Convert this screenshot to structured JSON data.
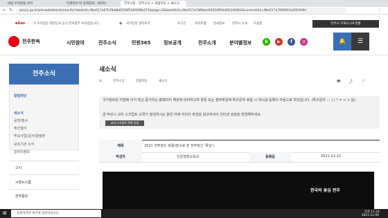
{
  "tabs": [
    "네음 우리말을 의지",
    "'인센티브'의 검색결과 : 네이버",
    "전주시청 - 전주소식 > 알림마당 > 새소식"
  ],
  "url": "jeonju.go.kr/planweb/board/view.9is?dataUid=9be517a67b78a6b01f34f53b50f6b471&page=3&boardUid=9be517a74f8dee91014f90e8502d0602&contentUid=9be517a7699063e5f01fd9e",
  "gov_banner": "이 누리집은 대한민국 공식 전자정부 누리집입니다.",
  "util": [
    "로그인",
    "사이트맵",
    "날씨정보",
    "전주시 소개",
    "도움말"
  ],
  "lang": "LANGUAGE",
  "logo": "전주한옥",
  "nav": [
    "시민참여",
    "전주소식",
    "민원365",
    "정보공개",
    "전주소개",
    "분야별정보"
  ],
  "covid_btn": "전주시 코로나-19 현황",
  "sidebar": {
    "title": "전주소식",
    "section": "알림마당",
    "items": [
      "새소식",
      "공연/행사",
      "주간행사",
      "주요사업(공사)알림판",
      "보조기관 소식",
      "일자리정보"
    ],
    "groups": [
      "고시",
      "시정뉴스룸",
      "전주홍보"
    ]
  },
  "page": {
    "title": "새소식",
    "crumbs": [
      "전주소식",
      "알림마당",
      "새소식"
    ]
  },
  "notice": {
    "line1": "국가정보원 지침에 의거 최근 증가하는 홈페이지 해킹에 대비하고자 본문 또는 첨부파일에 특수문자 포함 시 게시글 등록이 자동으로 차단됩니다. (특수문자 : ; ) ( * = < > 등)",
    "line2": "글 작성시 교차 스크립트 오류가 발생하시는 분은 아래 이미지 파일을 참고하셔서 인터넷 설정을 변경해주세요.",
    "btn": "교차 스크립트 적용 방법"
  },
  "post": {
    "label_title": "제목",
    "title": "2021 전주정신 포럼(장소로 본 전주정신 '꽃심')",
    "label_author": "작성자",
    "author": "인문행정교육과",
    "label_date": "등록일",
    "date": "2021-11-22"
  },
  "banner_text": "한국의 꽃심 전주",
  "taskbar": {
    "search": "검색하려면 여기에 입력하십시오.",
    "time": "오후 11:33",
    "date": "2021-12-09"
  },
  "colors": {
    "primary": "#3b6fb3",
    "accent": "#e60012"
  }
}
